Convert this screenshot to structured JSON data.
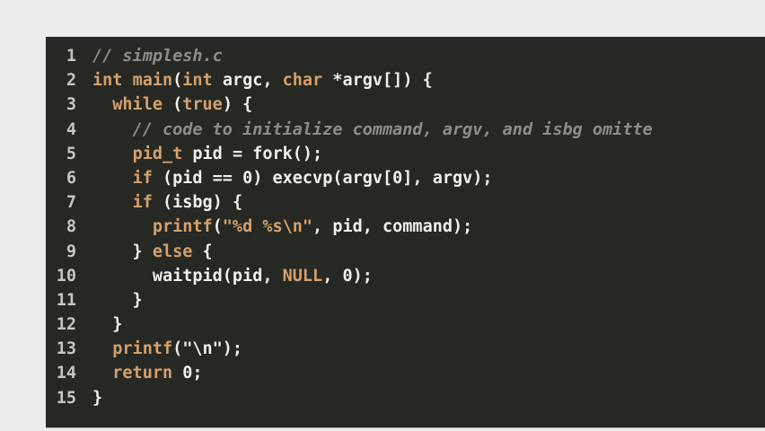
{
  "editor": {
    "lines": [
      {
        "n": "1",
        "parts": [
          {
            "t": "// simplesh.c",
            "c": "cm"
          }
        ]
      },
      {
        "n": "2",
        "parts": [
          {
            "t": "int",
            "c": "kw"
          },
          {
            "t": " ",
            "c": "txt"
          },
          {
            "t": "main",
            "c": "kw"
          },
          {
            "t": "(",
            "c": "txt"
          },
          {
            "t": "int",
            "c": "kw"
          },
          {
            "t": " argc, ",
            "c": "txt"
          },
          {
            "t": "char",
            "c": "kw"
          },
          {
            "t": " *argv[]) {",
            "c": "txt"
          }
        ]
      },
      {
        "n": "3",
        "parts": [
          {
            "t": "  ",
            "c": "txt"
          },
          {
            "t": "while",
            "c": "kw"
          },
          {
            "t": " (",
            "c": "txt"
          },
          {
            "t": "true",
            "c": "kw"
          },
          {
            "t": ") {",
            "c": "txt"
          }
        ]
      },
      {
        "n": "4",
        "parts": [
          {
            "t": "    ",
            "c": "txt"
          },
          {
            "t": "// code to initialize command, argv, and isbg omitte",
            "c": "cm"
          }
        ]
      },
      {
        "n": "5",
        "parts": [
          {
            "t": "    ",
            "c": "txt"
          },
          {
            "t": "pid_t",
            "c": "kw"
          },
          {
            "t": " pid = fork();",
            "c": "txt"
          }
        ]
      },
      {
        "n": "6",
        "parts": [
          {
            "t": "    ",
            "c": "txt"
          },
          {
            "t": "if",
            "c": "kw"
          },
          {
            "t": " (pid == 0) execvp(argv[0], argv);",
            "c": "txt"
          }
        ]
      },
      {
        "n": "7",
        "parts": [
          {
            "t": "    ",
            "c": "txt"
          },
          {
            "t": "if",
            "c": "kw"
          },
          {
            "t": " (isbg) {",
            "c": "txt"
          }
        ]
      },
      {
        "n": "8",
        "parts": [
          {
            "t": "      ",
            "c": "txt"
          },
          {
            "t": "printf",
            "c": "kw"
          },
          {
            "t": "(",
            "c": "txt"
          },
          {
            "t": "\"%d %s\\n\"",
            "c": "st"
          },
          {
            "t": ", pid, command);",
            "c": "txt"
          }
        ]
      },
      {
        "n": "9",
        "parts": [
          {
            "t": "    } ",
            "c": "txt"
          },
          {
            "t": "else",
            "c": "kw"
          },
          {
            "t": " {",
            "c": "txt"
          }
        ]
      },
      {
        "n": "10",
        "parts": [
          {
            "t": "      waitpid(pid, ",
            "c": "txt"
          },
          {
            "t": "NULL",
            "c": "kw"
          },
          {
            "t": ", 0);",
            "c": "txt"
          }
        ]
      },
      {
        "n": "11",
        "parts": [
          {
            "t": "    }",
            "c": "txt"
          }
        ]
      },
      {
        "n": "12",
        "parts": [
          {
            "t": "  }",
            "c": "txt"
          }
        ]
      },
      {
        "n": "13",
        "parts": [
          {
            "t": "  ",
            "c": "txt"
          },
          {
            "t": "printf",
            "c": "kw"
          },
          {
            "t": "(\"\\n\");",
            "c": "txt"
          }
        ]
      },
      {
        "n": "14",
        "parts": [
          {
            "t": "  ",
            "c": "txt"
          },
          {
            "t": "return",
            "c": "kw"
          },
          {
            "t": " 0;",
            "c": "txt"
          }
        ]
      },
      {
        "n": "15",
        "parts": [
          {
            "t": "}",
            "c": "txt"
          }
        ]
      }
    ]
  }
}
